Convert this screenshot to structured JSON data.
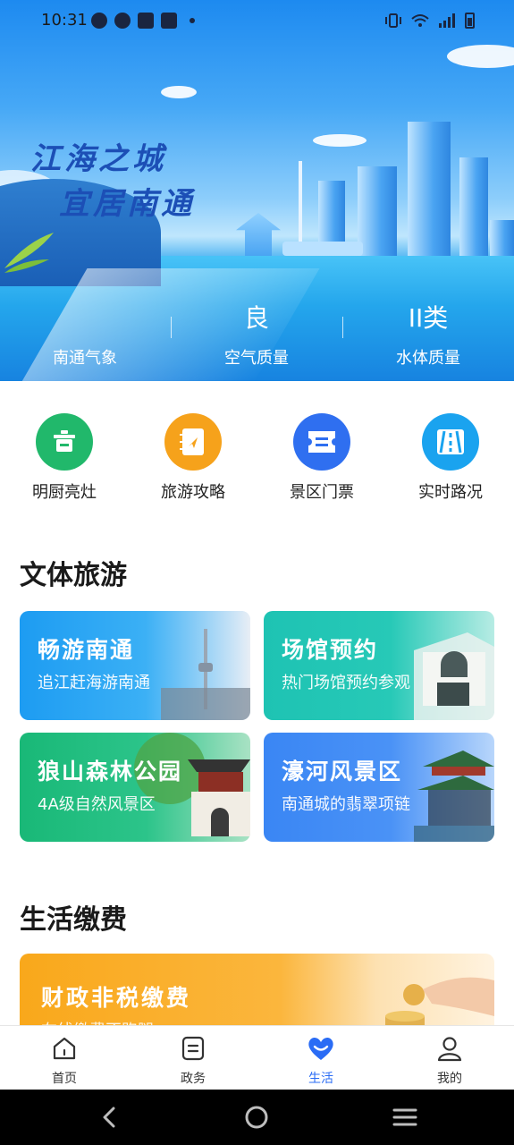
{
  "status_bar": {
    "time": "10:31"
  },
  "hero": {
    "slogan_line1": "江海之城",
    "slogan_line2": "宜居南通",
    "metrics": [
      {
        "value": "",
        "label": "南通气象"
      },
      {
        "value": "良",
        "label": "空气质量"
      },
      {
        "value": "II类",
        "label": "水体质量"
      }
    ]
  },
  "quick_entries": [
    {
      "label": "明厨亮灶",
      "color": "#21b86b",
      "icon": "pot-icon"
    },
    {
      "label": "旅游攻略",
      "color": "#f6a21b",
      "icon": "guidebook-icon"
    },
    {
      "label": "景区门票",
      "color": "#2f6ff0",
      "icon": "ticket-icon"
    },
    {
      "label": "实时路况",
      "color": "#1aa3ef",
      "icon": "road-icon"
    }
  ],
  "culture_tourism": {
    "title": "文体旅游",
    "cards": [
      {
        "title": "畅游南通",
        "subtitle": "追江赶海游南通"
      },
      {
        "title": "场馆预约",
        "subtitle": "热门场馆预约参观"
      },
      {
        "title": "狼山森林公园",
        "subtitle": "4A级自然风景区"
      },
      {
        "title": "濠河风景区",
        "subtitle": "南通城的翡翠项链"
      }
    ]
  },
  "life_payment": {
    "title": "生活缴费",
    "card": {
      "title": "财政非税缴费",
      "subtitle": "在线缴费不跑腿"
    }
  },
  "tabbar": [
    {
      "label": "首页",
      "icon": "home-icon"
    },
    {
      "label": "政务",
      "icon": "document-icon"
    },
    {
      "label": "生活",
      "icon": "heart-icon"
    },
    {
      "label": "我的",
      "icon": "user-icon"
    }
  ],
  "colors": {
    "accent": "#2a6cf5",
    "green": "#21b86b",
    "orange": "#f6a21b",
    "blue": "#2f6ff0",
    "cyan": "#1aa3ef"
  }
}
